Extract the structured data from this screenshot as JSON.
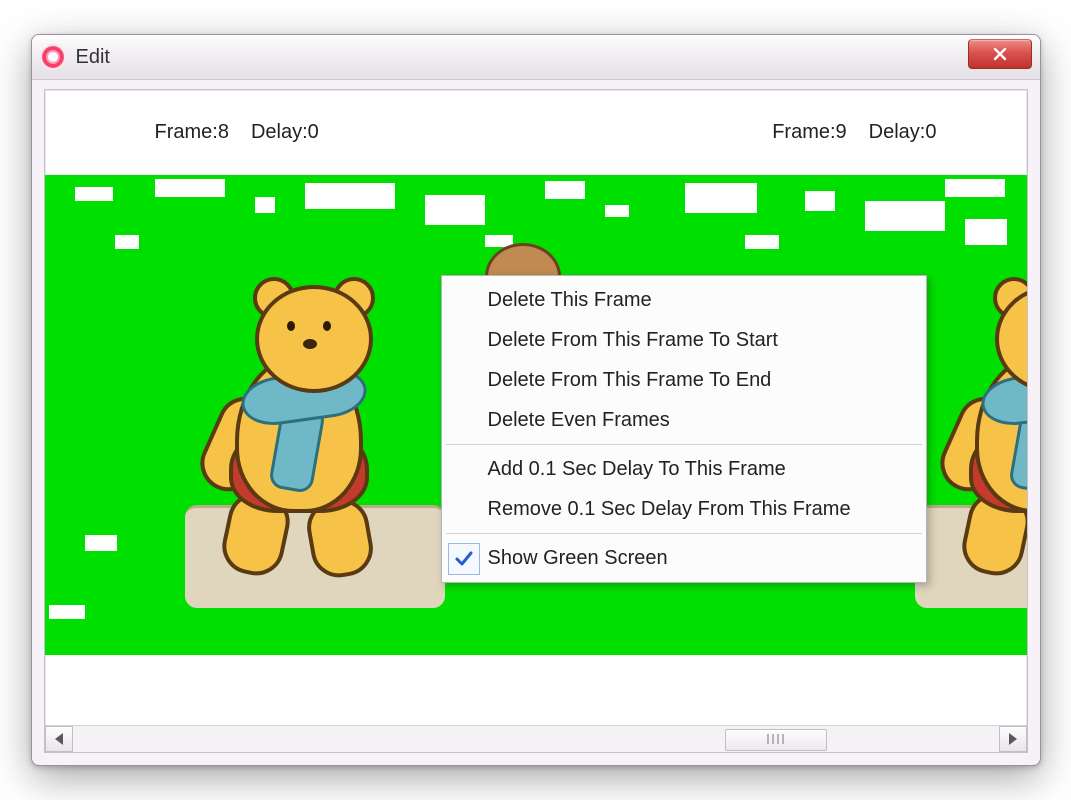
{
  "window": {
    "title": "Edit"
  },
  "frames": {
    "left": {
      "label_frame": "Frame:",
      "num": "8",
      "label_delay": "Delay:",
      "delay": "0"
    },
    "right": {
      "label_frame": "Frame:",
      "num": "9",
      "label_delay": "Delay:",
      "delay": "0"
    }
  },
  "context_menu": {
    "items": [
      "Delete This Frame",
      "Delete From This Frame To Start",
      "Delete From This Frame To End",
      "Delete Even Frames",
      "Add 0.1 Sec Delay To This Frame",
      "Remove 0.1 Sec Delay From This Frame",
      "Show Green Screen"
    ],
    "checked_index": 6
  }
}
